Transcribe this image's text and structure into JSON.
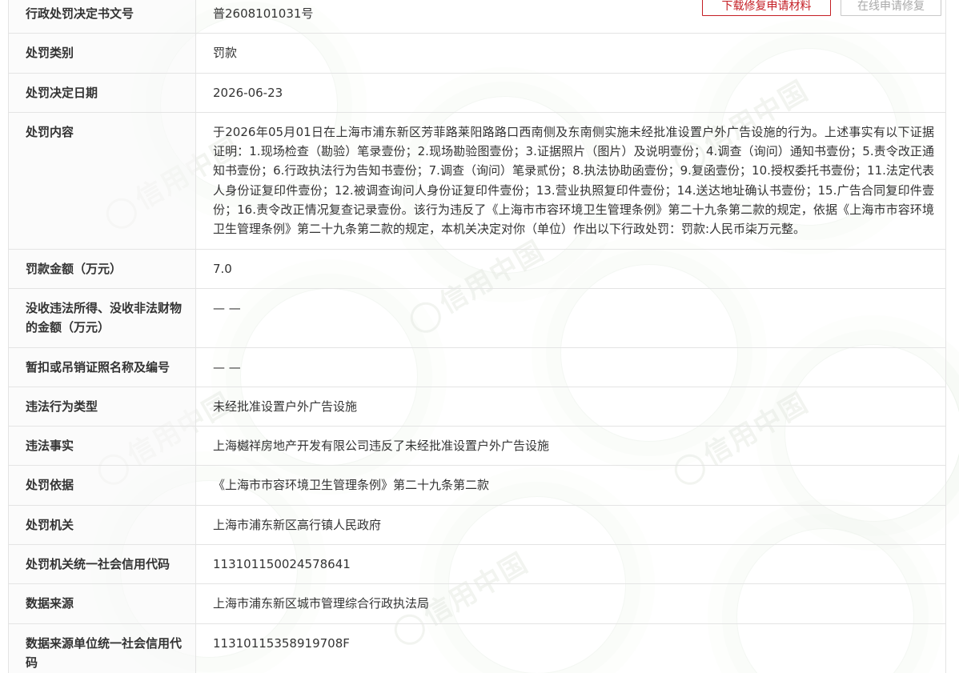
{
  "actions": {
    "download_label": "下载修复申请材料",
    "online_label": "在线申请修复"
  },
  "watermark": {
    "text": "信用中国"
  },
  "rows": {
    "doc_no": {
      "label": "行政处罚决定书文号",
      "value": "普2608101031号"
    },
    "category": {
      "label": "处罚类别",
      "value": "罚款"
    },
    "date": {
      "label": "处罚决定日期",
      "value": "2026-06-23"
    },
    "content": {
      "label": "处罚内容",
      "value": "于2026年05月01日在上海市浦东新区芳菲路莱阳路路口西南侧及东南侧实施未经批准设置户外广告设施的行为。上述事实有以下证据证明：1.现场检查（勘验）笔录壹份；2.现场勘验图壹份；3.证据照片（图片）及说明壹份；4.调查（询问）通知书壹份；5.责令改正通知书壹份；6.行政执法行为告知书壹份；7.调查（询问）笔录贰份；8.执法协助函壹份；9.复函壹份；10.授权委托书壹份；11.法定代表人身份证复印件壹份；12.被调查询问人身份证复印件壹份；13.营业执照复印件壹份；14.送达地址确认书壹份；15.广告合同复印件壹份；16.责令改正情况复查记录壹份。该行为违反了《上海市市容环境卫生管理条例》第二十九条第二款的规定，依据《上海市市容环境卫生管理条例》第二十九条第二款的规定，本机关决定对你（单位）作出以下行政处罚：罚款:人民币柒万元整。"
    },
    "amount": {
      "label": "罚款金额（万元）",
      "value": "7.0"
    },
    "confiscated": {
      "label": "没收违法所得、没收非法财物的金额（万元）",
      "value": "— —"
    },
    "license": {
      "label": "暂扣或吊销证照名称及编号",
      "value": "— —"
    },
    "violation_type": {
      "label": "违法行为类型",
      "value": "未经批准设置户外广告设施"
    },
    "violation_fact": {
      "label": "违法事实",
      "value": "上海樾祥房地产开发有限公司违反了未经批准设置户外广告设施"
    },
    "basis": {
      "label": "处罚依据",
      "value": "《上海市市容环境卫生管理条例》第二十九条第二款"
    },
    "authority": {
      "label": "处罚机关",
      "value": "上海市浦东新区高行镇人民政府"
    },
    "authority_code": {
      "label": "处罚机关统一社会信用代码",
      "value": "11310115002457864​1"
    },
    "source": {
      "label": "数据来源",
      "value": "上海市浦东新区城市管理综合行政执法局"
    },
    "source_code": {
      "label": "数据来源单位统一社会信用代码",
      "value": "11310115358919708F"
    }
  }
}
